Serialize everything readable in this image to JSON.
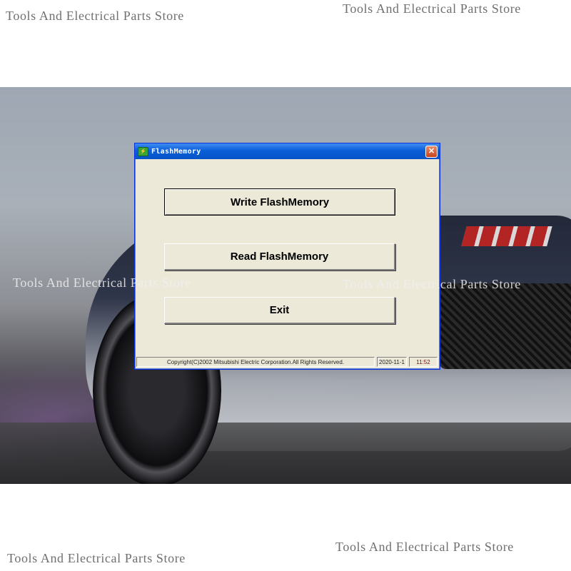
{
  "watermarks": {
    "top_left": "Tools And Electrical Parts Store",
    "top_right": "Tools And Electrical Parts Store",
    "middle_left": "Tools And Electrical Parts Store",
    "middle_right": "Tools And Electrical Parts Store",
    "bottom_left": "Tools And Electrical Parts Store",
    "bottom_right": "Tools And Electrical Parts Store"
  },
  "window": {
    "title": "FlashMemory",
    "icon": "flash-app-icon",
    "close_label": "✕"
  },
  "buttons": {
    "write": "Write FlashMemory",
    "read": "Read FlashMemory",
    "exit": "Exit"
  },
  "statusbar": {
    "copyright": "Copyright(C)2002 Mitsubishi Electric Corporation.All Rights Reserved.",
    "date": "2020-11-1",
    "time": "11:52"
  },
  "colors": {
    "titlebar": "#0a5fd8",
    "dialog_bg": "#ece9d8",
    "close_button": "#c8431f"
  }
}
